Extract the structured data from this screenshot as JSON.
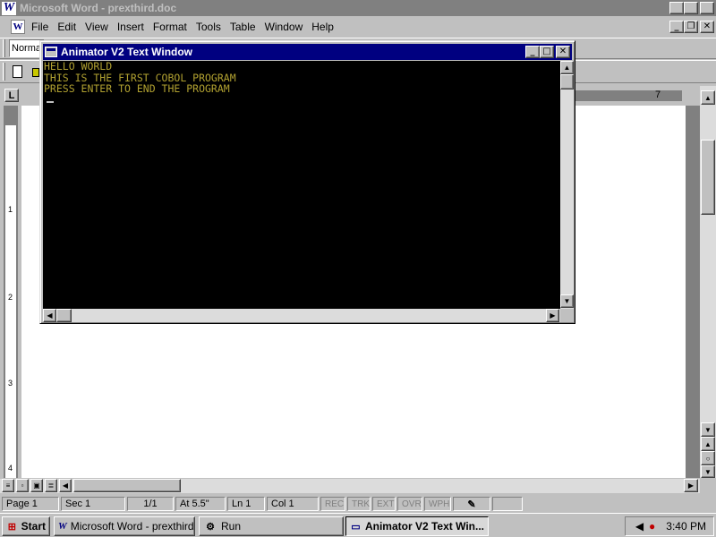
{
  "word": {
    "title": "Microsoft Word - prexthird.doc",
    "menu": [
      "File",
      "Edit",
      "View",
      "Insert",
      "Format",
      "Tools",
      "Table",
      "Window",
      "Help"
    ],
    "style_value": "Normal",
    "ruler_mark": "7",
    "vruler_marks": [
      "1",
      "2",
      "3",
      "4"
    ]
  },
  "status": {
    "page": "Page 1",
    "sec": "Sec 1",
    "pages": "1/1",
    "at": "At 5.5\"",
    "ln": "Ln 1",
    "col": "Col 1",
    "modes": [
      "REC",
      "TRK",
      "EXT",
      "OVR",
      "WPH"
    ]
  },
  "animator": {
    "title": "Animator V2 Text Window",
    "lines": [
      "HELLO WORLD",
      "THIS IS THE FIRST COBOL PROGRAM",
      "PRESS ENTER TO END THE PROGRAM"
    ],
    "text_color": "#b0a030"
  },
  "taskbar": {
    "start": "Start",
    "buttons": [
      "Microsoft Word - prexthird...",
      "Run",
      "Animator V2 Text Win..."
    ],
    "clock": "3:40 PM"
  }
}
